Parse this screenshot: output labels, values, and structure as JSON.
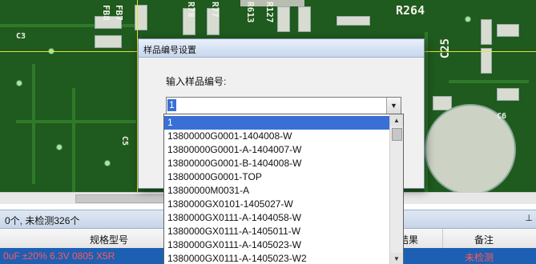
{
  "pcb": {
    "labels": [
      "FB8",
      "FB7",
      "R78",
      "R77",
      "R613",
      "R127",
      "R264",
      "C25",
      "C3",
      "C5",
      "C6"
    ]
  },
  "dialog": {
    "title": "样品编号设置",
    "prompt": "输入样品编号:",
    "combo_value": "1",
    "arrow_glyph": "▼"
  },
  "dropdown": {
    "items": [
      "1",
      "13800000G0001-1404008-W",
      "13800000G0001-A-1404007-W",
      "13800000G0001-B-1404008-W",
      "13800000G0001-TOP",
      "13800000M0031-A",
      "1380000GX0101-1405027-W",
      "1380000GX0111-A-1404058-W",
      "1380000GX0111-A-1405011-W",
      "1380000GX0111-A-1405023-W",
      "1380000GX0111-A-1405023-W2"
    ],
    "selected_index": 0,
    "scroll_up": "▲",
    "scroll_down": "▼"
  },
  "statusbar": {
    "text": "0个, 未检测326个",
    "pin": "⊥"
  },
  "grid": {
    "headers": [
      "规格型号",
      "结果",
      "备注"
    ],
    "row": [
      "0uF ±20% 6.3V 0805 X5R",
      "",
      "未检测"
    ]
  }
}
